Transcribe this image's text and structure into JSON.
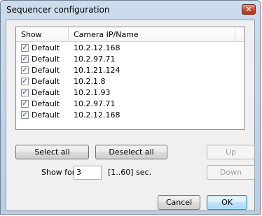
{
  "window": {
    "title": "Sequencer configuration",
    "close_glyph": "✕"
  },
  "list": {
    "columns": [
      "Show",
      "Camera IP/Name"
    ],
    "rows": [
      {
        "checked": true,
        "name": "Default",
        "ip": "10.2.12.168"
      },
      {
        "checked": true,
        "name": "Default",
        "ip": "10.2.97.71"
      },
      {
        "checked": true,
        "name": "Default",
        "ip": "10.1.21.124"
      },
      {
        "checked": true,
        "name": "Default",
        "ip": "10.2.1.8"
      },
      {
        "checked": true,
        "name": "Default",
        "ip": "10.2.1.93"
      },
      {
        "checked": true,
        "name": "Default",
        "ip": "10.2.97.71"
      },
      {
        "checked": true,
        "name": "Default",
        "ip": "10.2.12.168"
      }
    ]
  },
  "buttons": {
    "select_all": "Select all",
    "deselect_all": "Deselect all",
    "up": "Up",
    "down": "Down",
    "cancel": "Cancel",
    "ok": "OK"
  },
  "show_for": {
    "label": "Show for",
    "value": "3",
    "range": "[1..60] sec."
  },
  "colors": {
    "accent": "#3c7fb1",
    "close": "#c7462c"
  }
}
